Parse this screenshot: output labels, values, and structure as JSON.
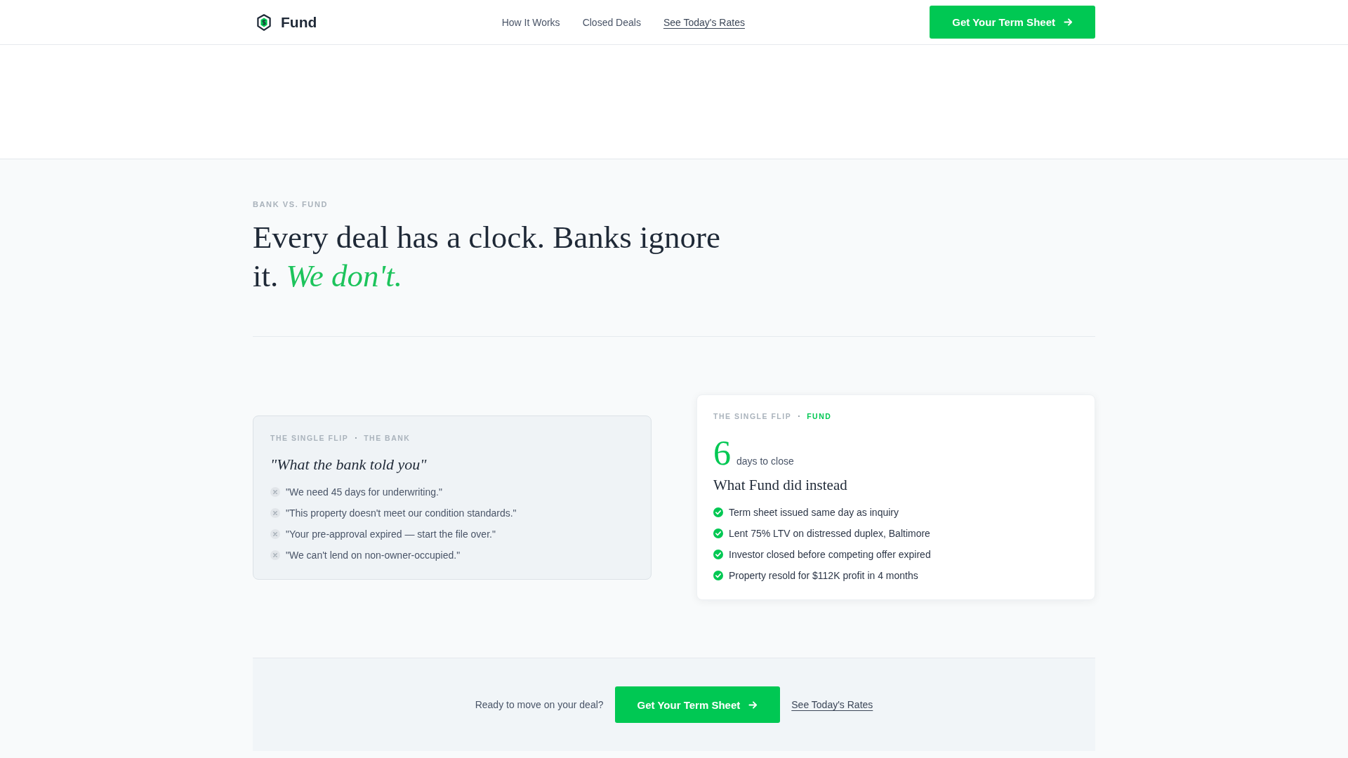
{
  "header": {
    "brand": "Fund",
    "nav": [
      {
        "label": "How It Works",
        "kind": "plain"
      },
      {
        "label": "Closed Deals",
        "kind": "plain"
      },
      {
        "label": "See Today's Rates",
        "kind": "link"
      }
    ],
    "cta": "Get Your Term Sheet"
  },
  "comparison": {
    "eyebrow": "BANK VS. FUND",
    "headline": "Every deal has a clock. Banks ignore it. *We don't.*"
  },
  "bank_card": {
    "eyebrow": "THE SINGLE FLIP",
    "separator": "·",
    "source": "THE BANK",
    "title": "\"What the bank told you\"",
    "items": [
      "\"We need 45 days for underwriting.\"",
      "\"This property doesn't meet our condition standards.\"",
      "\"Your pre-approval expired — start the file over.\"",
      "\"We can't lend on non-owner-occupied.\""
    ]
  },
  "fund_card": {
    "eyebrow": "THE SINGLE FLIP",
    "separator": "·",
    "source": "FUND",
    "stat": {
      "value": "6",
      "label": "days to close"
    },
    "title": "What Fund did instead",
    "items": [
      "Term sheet issued same day as inquiry",
      "Lent 75% LTV on distressed duplex, Baltimore",
      "Investor closed before competing offer expired",
      "Property resold for $112K profit in 4 months"
    ]
  },
  "cta_band": {
    "prompt": "Ready to move on your deal?",
    "button": "Get Your Term Sheet",
    "link": "See Today's Rates"
  }
}
